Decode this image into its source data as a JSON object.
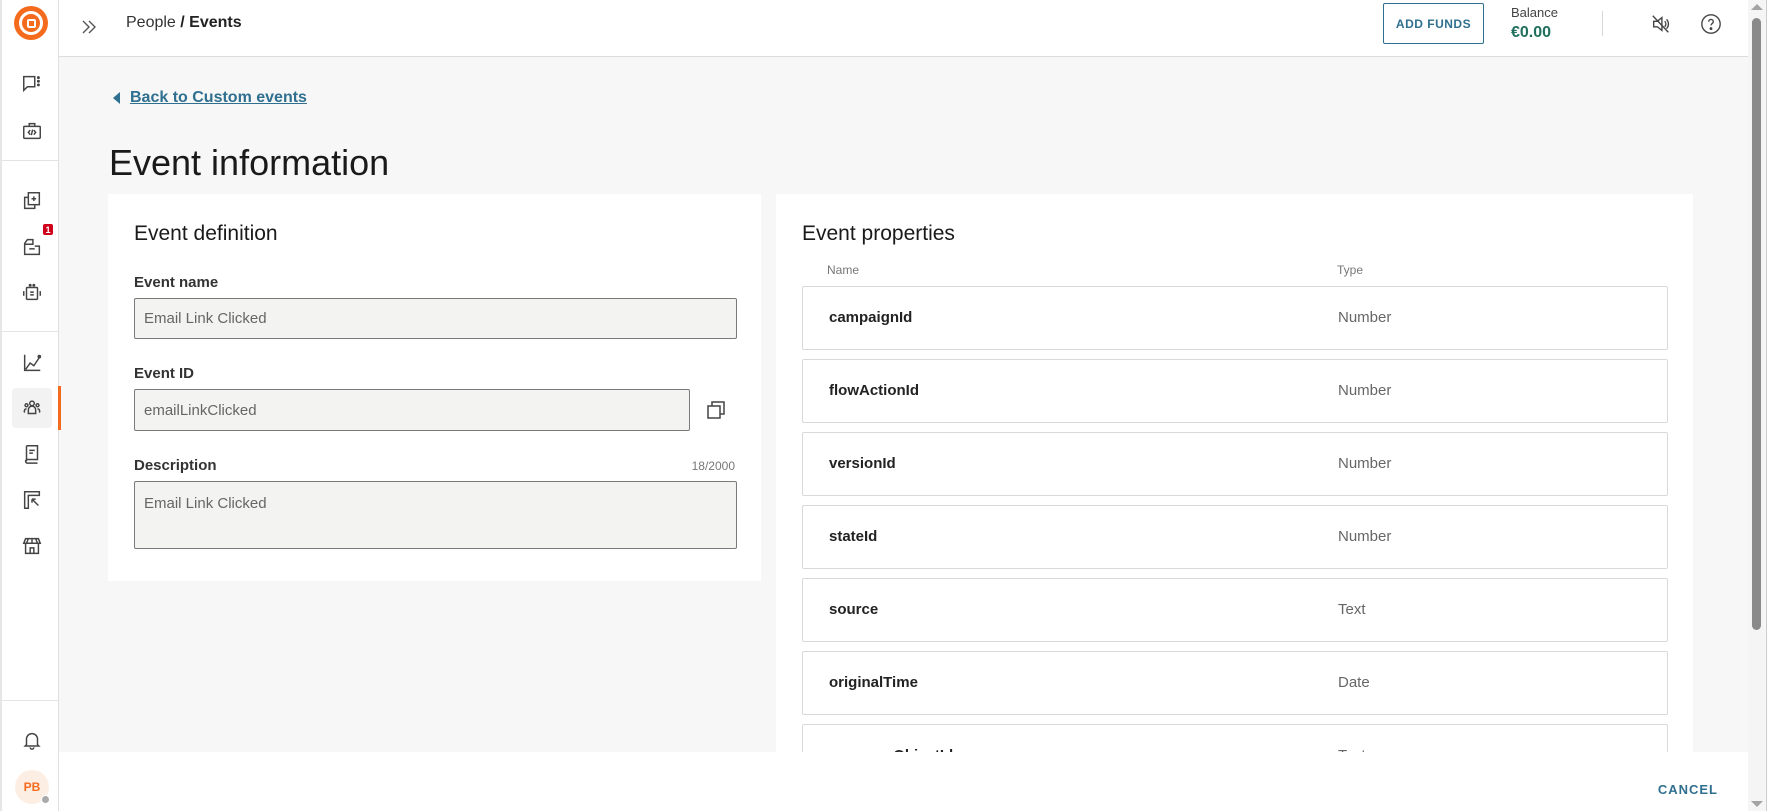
{
  "sidebar": {
    "logo": "brand-logo",
    "items": [
      {
        "name": "conversations",
        "icon": "chat-icon"
      },
      {
        "name": "developer-tools",
        "icon": "code-briefcase-icon"
      },
      {
        "name": "templates",
        "icon": "templates-icon"
      },
      {
        "name": "channels",
        "icon": "inbox-icon",
        "badge": "1"
      },
      {
        "name": "automation",
        "icon": "robot-icon"
      },
      {
        "name": "analytics",
        "icon": "chart-icon"
      },
      {
        "name": "people",
        "icon": "people-icon",
        "active": true
      },
      {
        "name": "docs",
        "icon": "book-icon"
      },
      {
        "name": "exports",
        "icon": "export-icon"
      },
      {
        "name": "marketplace",
        "icon": "store-icon"
      }
    ],
    "notifications_icon": "bell-icon",
    "avatar_initials": "PB"
  },
  "header": {
    "breadcrumb_parent": "People",
    "breadcrumb_sep": " / ",
    "breadcrumb_current": "Events",
    "add_funds_label": "ADD FUNDS",
    "balance_label": "Balance",
    "balance_value": "€0.00"
  },
  "page": {
    "back_link": "Back to Custom events",
    "title": "Event information"
  },
  "definition": {
    "title": "Event definition",
    "event_name_label": "Event name",
    "event_name_value": "Email Link Clicked",
    "event_id_label": "Event ID",
    "event_id_value": "emailLinkClicked",
    "description_label": "Description",
    "description_counter": "18/2000",
    "description_value": "Email Link Clicked"
  },
  "properties": {
    "title": "Event properties",
    "col_name": "Name",
    "col_type": "Type",
    "rows": [
      {
        "name": "campaignId",
        "type": "Number"
      },
      {
        "name": "flowActionId",
        "type": "Number"
      },
      {
        "name": "versionId",
        "type": "Number"
      },
      {
        "name": "stateId",
        "type": "Number"
      },
      {
        "name": "source",
        "type": "Text"
      },
      {
        "name": "originalTime",
        "type": "Date"
      },
      {
        "name": "messageObjectId",
        "type": "Text"
      }
    ]
  },
  "footer": {
    "cancel_label": "CANCEL"
  },
  "colors": {
    "brand": "#f56b1d",
    "link": "#2f6f8f",
    "balance": "#1f6f5c",
    "badge": "#d0021b"
  }
}
